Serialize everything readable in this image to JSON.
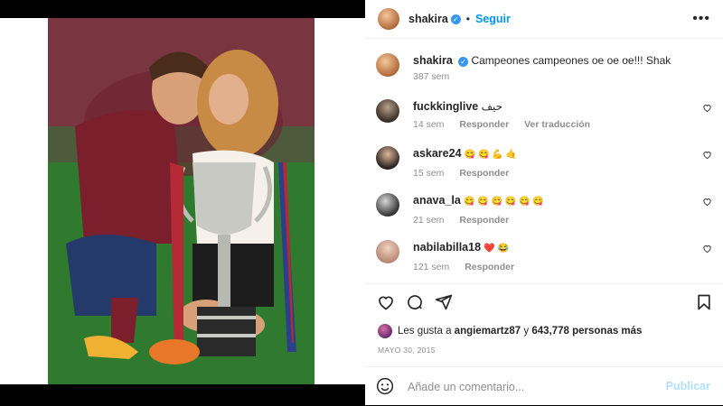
{
  "post_header": {
    "username": "shakira",
    "verified_mark": "✓",
    "separator": "•",
    "follow_label": "Seguir",
    "more_icon": "more-horizontal-icon",
    "more_label": "•••"
  },
  "caption": {
    "username": "shakira",
    "text": "Campeones campeones oe oe oe!!! Shak",
    "time": "387 sem"
  },
  "comments": [
    {
      "username": "fuckkinglive",
      "text": "حيف",
      "time": "14 sem",
      "reply_label": "Responder",
      "translate_label": "Ver traducción"
    },
    {
      "username": "askare24",
      "text": "😋 😋 💪 🤙",
      "time": "15 sem",
      "reply_label": "Responder"
    },
    {
      "username": "anava_la",
      "text": "😋 😋 😋 😋 😋 😋",
      "time": "21 sem",
      "reply_label": "Responder"
    },
    {
      "username": "nabilabilla18",
      "text": "❤️ 😂",
      "time": "121 sem",
      "reply_label": "Responder"
    }
  ],
  "actions": {
    "like_icon": "heart-icon",
    "comment_icon": "comment-icon",
    "share_icon": "send-icon",
    "save_icon": "bookmark-icon"
  },
  "likes": {
    "prefix": "Les gusta a",
    "user": "angiemartz87",
    "joiner": "y",
    "count": "643,778 personas más"
  },
  "date": "MAYO 30, 2015",
  "comment_box": {
    "emoji_icon": "emoji-icon",
    "placeholder": "Añade un comentario...",
    "publish_label": "Publicar"
  },
  "colors": {
    "accent": "#0095f6",
    "publish_disabled": "#b2dffc",
    "verified": "#3897f0",
    "muted": "#8e8e8e",
    "text": "#262626"
  }
}
